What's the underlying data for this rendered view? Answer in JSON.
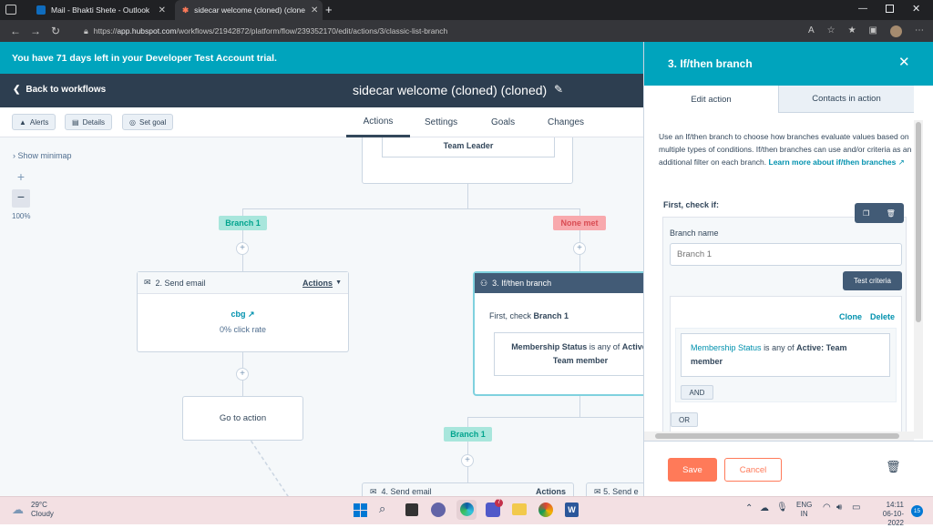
{
  "browser": {
    "tabs": [
      {
        "label": "Mail - Bhakti Shete - Outlook"
      },
      {
        "label": "sidecar welcome (cloned) (clone"
      }
    ],
    "url_prefix": "https://",
    "url_host": "app.hubspot.com",
    "url_path": "/workflows/21942872/platform/flow/239352170/edit/actions/3/classic-list-branch"
  },
  "trial_banner": "You have 71 days left in your Developer Test Account trial.",
  "header": {
    "back_label": "Back to workflows",
    "workflow_title": "sidecar welcome (cloned) (cloned)"
  },
  "toolbar": {
    "alerts_label": "Alerts",
    "details_label": "Details",
    "set_goal_label": "Set goal",
    "tabs": [
      "Actions",
      "Settings",
      "Goals",
      "Changes"
    ]
  },
  "canvas": {
    "show_minimap": "Show minimap",
    "zoom": "100%",
    "zoom_in": "+",
    "zoom_out": "−",
    "top_card_text": "Team Leader",
    "branch1_label": "Branch 1",
    "none_met_label": "None met",
    "send_email_card": {
      "title": "2. Send email",
      "actions_label": "Actions",
      "email_name": "cbg",
      "click_rate": "0% click rate"
    },
    "goto_label": "Go to action",
    "ifthen_card": {
      "title": "3. If/then branch",
      "first_check_prefix": "First, check",
      "first_check_branch": "Branch 1",
      "criteria_property": "Membership Status",
      "criteria_op": "is any of",
      "criteria_value": "Active:",
      "criteria_value2": "Team member"
    },
    "branch1_lower_label": "Branch 1",
    "send_email_4": "4. Send email",
    "actions_4": "Actions",
    "send_email_5": "5. Send e"
  },
  "panel": {
    "title": "3. If/then branch",
    "tabs": [
      "Edit action",
      "Contacts in action"
    ],
    "description": "Use an If/then branch to choose how branches evaluate values based on multiple types of conditions. If/then branches can use and/or criteria as an additional filter on each branch.",
    "learn_more": "Learn more about if/then branches",
    "first_check": "First, check if:",
    "branch_name_label": "Branch name",
    "branch_name_placeholder": "Branch 1",
    "test_criteria": "Test criteria",
    "clone": "Clone",
    "delete": "Delete",
    "criteria_property": "Membership Status",
    "criteria_op": "is any of",
    "criteria_value": "Active: Team member",
    "and_label": "AND",
    "or_label": "OR",
    "save": "Save",
    "cancel": "Cancel"
  },
  "taskbar": {
    "temp": "29°C",
    "weather": "Cloudy",
    "lang1": "ENG",
    "lang2": "IN",
    "time": "14:11",
    "date": "06-10-2022",
    "notif_count": "15",
    "teams_badge": "7"
  },
  "colors": {
    "teal": "#00a4bd",
    "navy": "#2d3e50",
    "branch_green_bg": "#a8e6dc",
    "branch_green_text": "#00a38d",
    "none_met_bg": "#f8a9ad",
    "none_met_text": "#d94c53",
    "save_orange": "#ff7a59"
  }
}
